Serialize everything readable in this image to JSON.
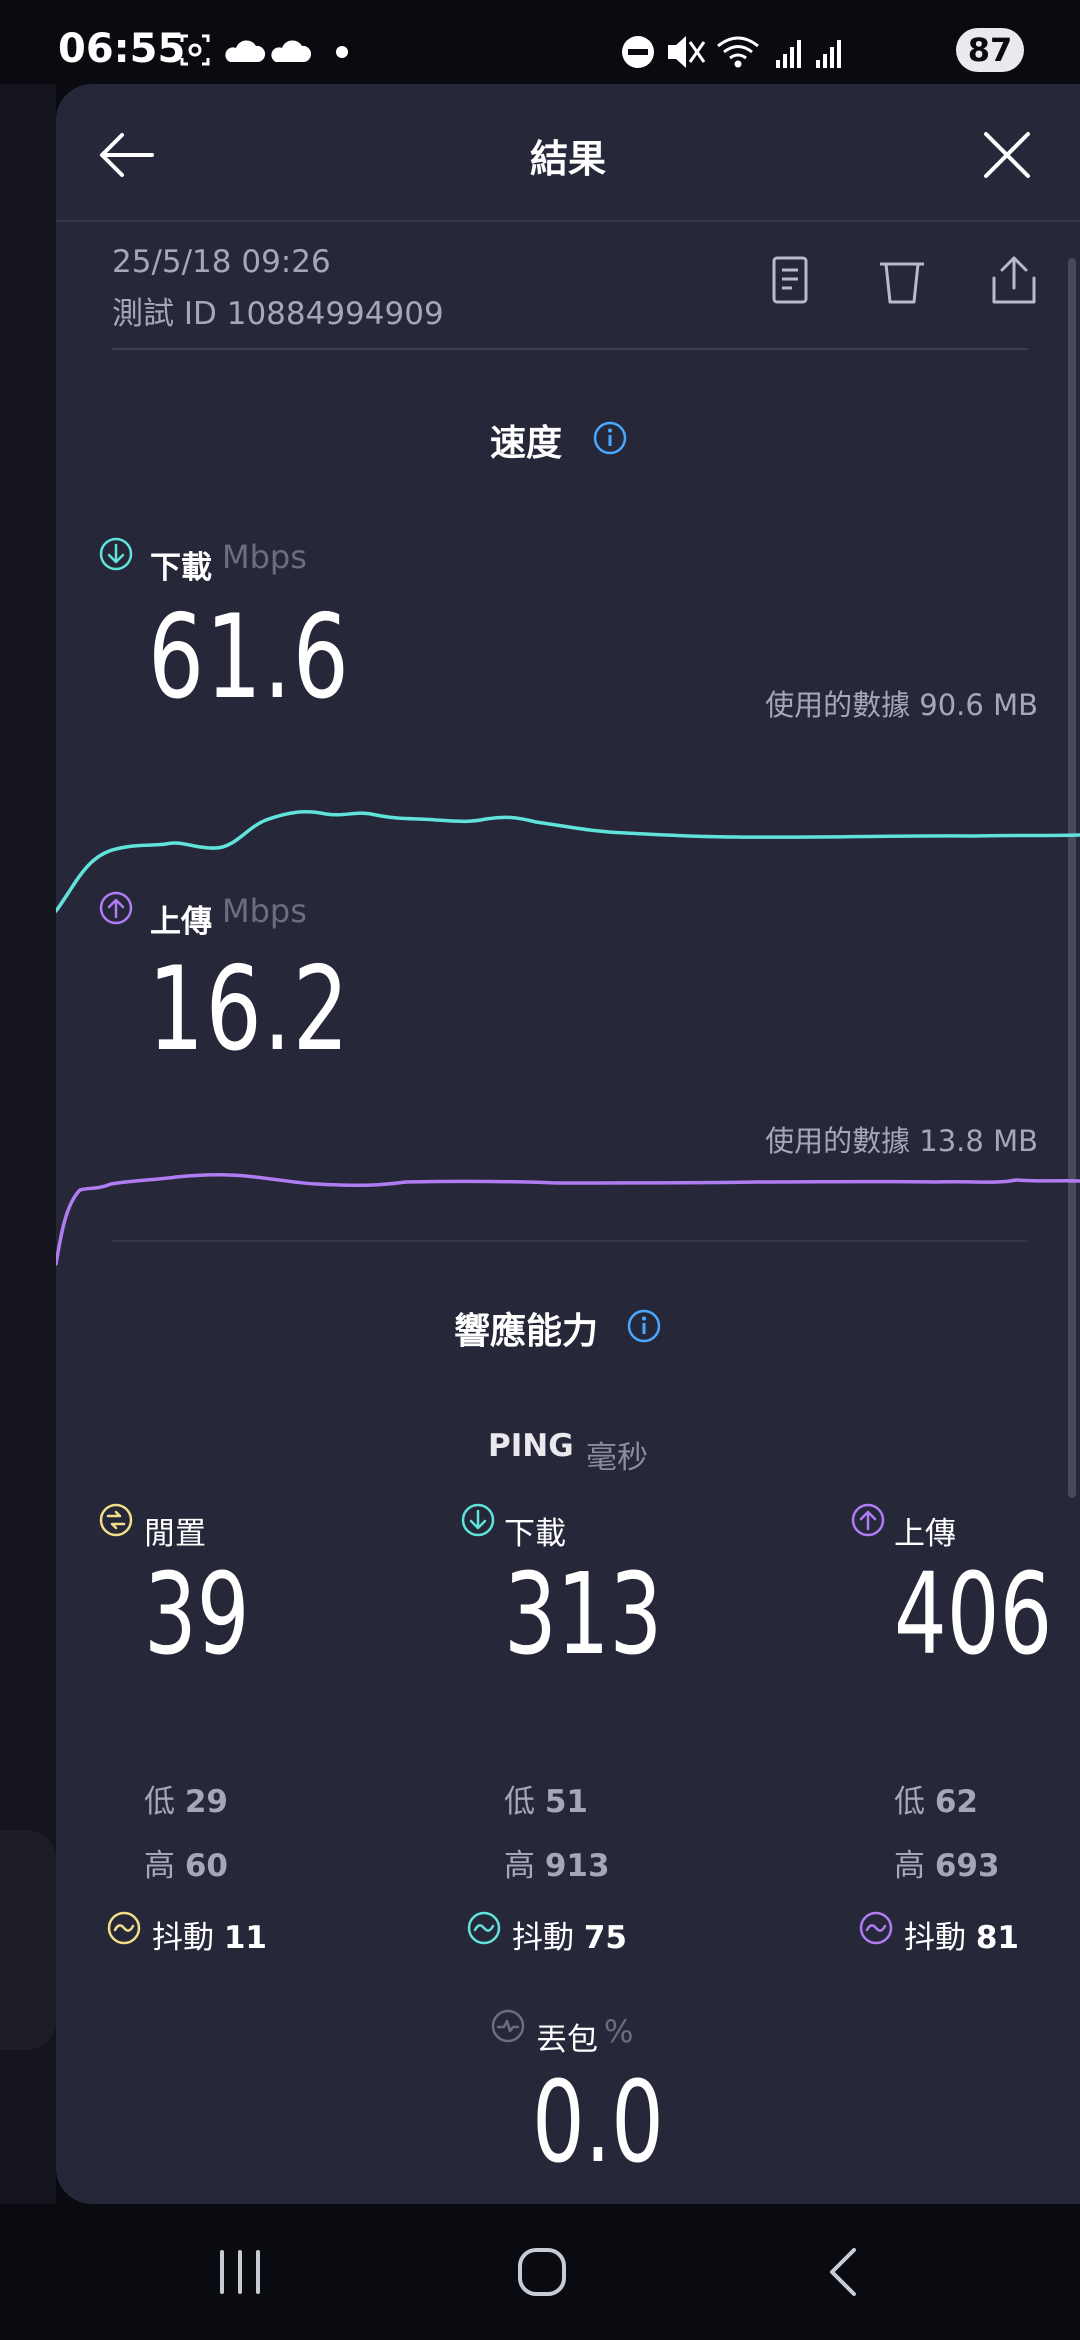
{
  "status_bar": {
    "time": "06:55",
    "battery": "87",
    "left_icons": [
      "screenshot-icon",
      "cloud-icon",
      "cloud-icon",
      "dot-icon"
    ],
    "right_icons": [
      "do-not-disturb-icon",
      "mute-icon",
      "wifi-icon",
      "signal-icon",
      "signal-icon"
    ]
  },
  "header": {
    "title": "結果"
  },
  "meta": {
    "date": "25/5/18 09:26",
    "test_id": "測試 ID 10884994909"
  },
  "speed": {
    "section_title": "速度",
    "download": {
      "label": "下載",
      "unit": "Mbps",
      "value": "61.6",
      "data_used": "使用的數據 90.6 MB",
      "color": "#5fe3da"
    },
    "upload": {
      "label": "上傳",
      "unit": "Mbps",
      "value": "16.2",
      "data_used": "使用的數據 13.8 MB",
      "color": "#b07cf2"
    }
  },
  "responsiveness": {
    "section_title": "響應能力",
    "ping_title": "PING",
    "ping_unit": "毫秒",
    "columns": [
      {
        "label": "閒置",
        "value": "39",
        "low_label": "低",
        "low": "29",
        "high_label": "高",
        "high": "60",
        "jitter_label": "抖動",
        "jitter": "11",
        "color": "#f2de8a"
      },
      {
        "label": "下載",
        "value": "313",
        "low_label": "低",
        "low": "51",
        "high_label": "高",
        "high": "913",
        "jitter_label": "抖動",
        "jitter": "75",
        "color": "#5fe3da"
      },
      {
        "label": "上傳",
        "value": "406",
        "low_label": "低",
        "low": "62",
        "high_label": "高",
        "high": "693",
        "jitter_label": "抖動",
        "jitter": "81",
        "color": "#b07cf2"
      }
    ],
    "packet_loss": {
      "label": "丟包",
      "unit": "%",
      "value": "0.0"
    }
  },
  "colors": {
    "accent_info": "#4aa8ff",
    "panel_bg": "#26283a"
  }
}
